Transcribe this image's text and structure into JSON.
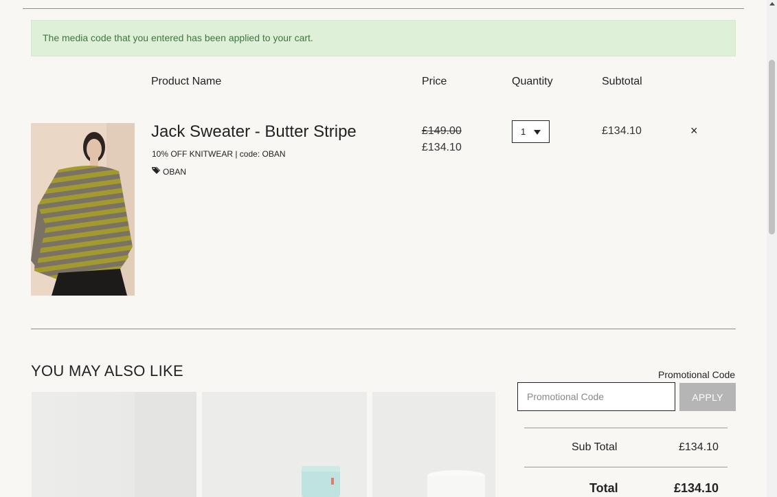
{
  "alert": {
    "message": "The media code that you entered has been applied to your cart."
  },
  "table": {
    "headers": {
      "product": "Product Name",
      "price": "Price",
      "quantity": "Quantity",
      "subtotal": "Subtotal"
    }
  },
  "item": {
    "name": "Jack Sweater - Butter Stripe",
    "promo": "10% OFF KNITWEAR | code: OBAN",
    "tag": "OBAN",
    "old_price": "£149.00",
    "price": "£134.10",
    "quantity": "1",
    "subtotal": "£134.10",
    "remove": "×"
  },
  "recommendations": {
    "title": "YOU MAY ALSO LIKE"
  },
  "promo": {
    "label": "Promotional Code",
    "placeholder": "Promotional Code",
    "apply_label": "APPLY"
  },
  "summary": {
    "subtotal_label": "Sub Total",
    "subtotal_value": "£134.10",
    "total_label": "Total",
    "total_value": "£134.10"
  },
  "colors": {
    "alert_bg": "#dff0d8",
    "alert_text": "#3c763d",
    "apply_bg": "#b5b5b5"
  }
}
